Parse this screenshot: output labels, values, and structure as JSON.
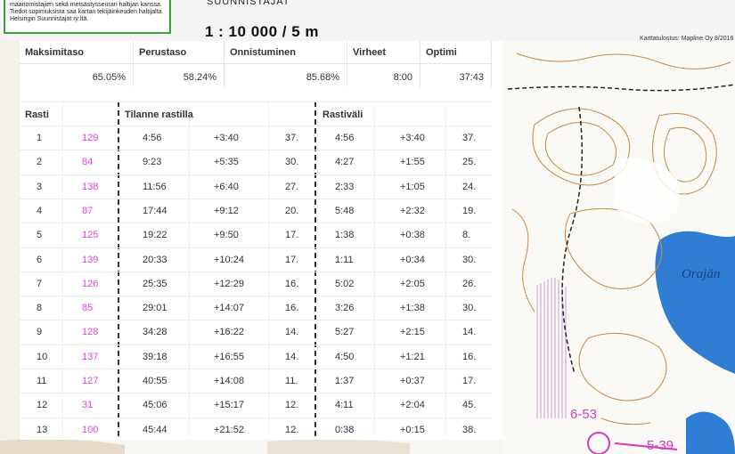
{
  "map": {
    "legend_text": "maanomistajien sekä metsästysseuran haltijan kanssa. Tiedot sopimuksista saa kartan tekijäinkeuden haltijalta Helsingin Suunnistajat ry:ltä.",
    "club": "SUUNNISTAJAT",
    "scale": "1 : 10 000 / 5 m",
    "print_note": "Karttatulostus: Mapline Oy  8/2016",
    "lake_label": "Orajän",
    "control_marks": [
      "6-53",
      "5-39"
    ],
    "colors": {
      "forest": "#f7f6f2",
      "contour": "#c9884a",
      "water": "#2f7ed4",
      "marsh": "#c79fd3",
      "open": "#ffffff"
    }
  },
  "summary": {
    "headers": [
      "Maksimitaso",
      "Perustaso",
      "Onnistuminen",
      "Virheet",
      "Optimi"
    ],
    "values": [
      "65.05%",
      "58.24%",
      "85.68%",
      "8:00",
      "37:43"
    ]
  },
  "table": {
    "headers": {
      "rasti": "Rasti",
      "situation": "Tilanne rastilla",
      "split": "Rastiväli"
    },
    "rows": [
      {
        "n": "1",
        "code": "129",
        "time": "4:56",
        "diff": "+3:40",
        "pos": "37.",
        "split": "4:56",
        "sdiff": "+3:40",
        "spos": "37."
      },
      {
        "n": "2",
        "code": "84",
        "time": "9:23",
        "diff": "+5:35",
        "pos": "30.",
        "split": "4:27",
        "sdiff": "+1:55",
        "spos": "25."
      },
      {
        "n": "3",
        "code": "138",
        "time": "11:56",
        "diff": "+6:40",
        "pos": "27.",
        "split": "2:33",
        "sdiff": "+1:05",
        "spos": "24."
      },
      {
        "n": "4",
        "code": "87",
        "time": "17:44",
        "diff": "+9:12",
        "pos": "20.",
        "split": "5:48",
        "sdiff": "+2:32",
        "spos": "19."
      },
      {
        "n": "5",
        "code": "125",
        "time": "19:22",
        "diff": "+9:50",
        "pos": "17.",
        "split": "1:38",
        "sdiff": "+0:38",
        "spos": "8."
      },
      {
        "n": "6",
        "code": "139",
        "time": "20:33",
        "diff": "+10:24",
        "pos": "17.",
        "split": "1:11",
        "sdiff": "+0:34",
        "spos": "30."
      },
      {
        "n": "7",
        "code": "126",
        "time": "25:35",
        "diff": "+12:29",
        "pos": "16.",
        "split": "5:02",
        "sdiff": "+2:05",
        "spos": "26."
      },
      {
        "n": "8",
        "code": "85",
        "time": "29:01",
        "diff": "+14:07",
        "pos": "16.",
        "split": "3:26",
        "sdiff": "+1:38",
        "spos": "30."
      },
      {
        "n": "9",
        "code": "128",
        "time": "34:28",
        "diff": "+16:22",
        "pos": "14.",
        "split": "5:27",
        "sdiff": "+2:15",
        "spos": "14."
      },
      {
        "n": "10",
        "code": "137",
        "time": "39:18",
        "diff": "+16:55",
        "pos": "14.",
        "split": "4:50",
        "sdiff": "+1:21",
        "spos": "16."
      },
      {
        "n": "11",
        "code": "127",
        "time": "40:55",
        "diff": "+14:08",
        "pos": "11.",
        "split": "1:37",
        "sdiff": "+0:37",
        "spos": "17."
      },
      {
        "n": "12",
        "code": "31",
        "time": "45:06",
        "diff": "+15:17",
        "pos": "12.",
        "split": "4:11",
        "sdiff": "+2:04",
        "spos": "45."
      },
      {
        "n": "13",
        "code": "100",
        "time": "45:44",
        "diff": "+21:52",
        "pos": "12.",
        "split": "0:38",
        "sdiff": "+0:15",
        "spos": "38."
      }
    ]
  }
}
